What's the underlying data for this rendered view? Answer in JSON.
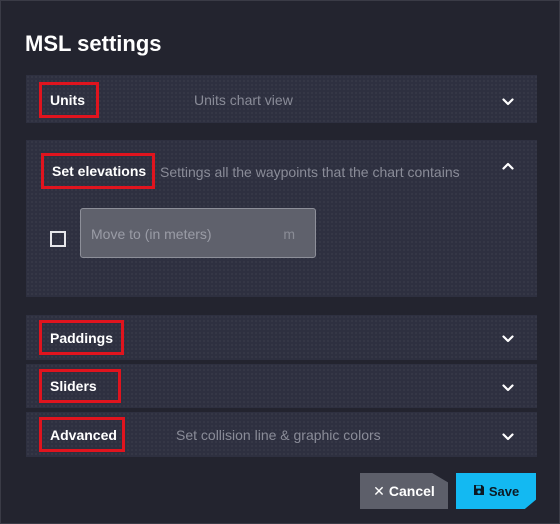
{
  "dialog": {
    "title": "MSL settings"
  },
  "sections": [
    {
      "label": "Units",
      "description": "Units chart view",
      "expanded": false,
      "chevron_icon": "chevron-down-icon"
    },
    {
      "label": "Set elevations",
      "description": "Settings all the waypoints that the chart contains",
      "expanded": true,
      "chevron_icon": "chevron-up-icon"
    },
    {
      "label": "Paddings",
      "description": "",
      "expanded": false,
      "chevron_icon": "chevron-down-icon"
    },
    {
      "label": "Sliders",
      "description": "",
      "expanded": false,
      "chevron_icon": "chevron-down-icon"
    },
    {
      "label": "Advanced",
      "description": "Set collision line & graphic colors",
      "expanded": false,
      "chevron_icon": "chevron-down-icon"
    }
  ],
  "set_elevations": {
    "checkbox_checked": false,
    "move_to_placeholder": "Move to (in meters)",
    "move_to_value": "",
    "unit": "m"
  },
  "footer": {
    "cancel_label": "Cancel",
    "cancel_icon": "close-icon",
    "save_label": "Save",
    "save_icon": "floppy-disk-icon"
  },
  "colors": {
    "highlight_border": "#e0141e",
    "save_accent": "#13b9f2",
    "dialog_bg": "#23242f",
    "panel_bg": "#2e3040"
  }
}
